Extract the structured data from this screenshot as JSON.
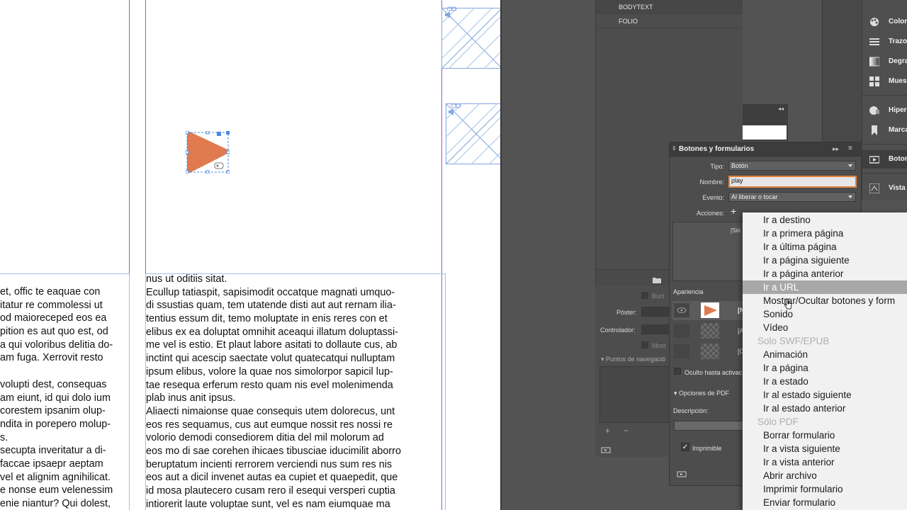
{
  "document": {
    "text_col_left": [
      "et, offic te eaquae con",
      "itatur re commolessi ut",
      "od maioreceped eos ea",
      "pition es aut quo est, od",
      "a qui voloribus delitia do-",
      "am fuga. Xerrovit resto",
      "",
      " volupti dest, consequas",
      "am eiunt, id qui dolo ium",
      "corestem ipsanim olup-",
      "ndita in porepero molup-",
      "s.",
      "secupta inveritatur a di-",
      " faccae ipsaepr aeptam",
      "vel et alignim agnihilicat.",
      "e nonse eum velenessim",
      "enie niantur? Qui dolest,"
    ],
    "text_col_right": [
      "nus ut oditiis sitat.",
      "Ecullup tatiaspit, sapisimodit occatque magnati umquo-",
      "di ssustias quam, tem utatende disti aut aut rernam ilia-",
      "tentius essum dit, temo moluptate in enis reres con et",
      "elibus ex ea doluptat omnihit aceaqui illatum doluptassi-",
      "me vel is estio. Et plaut labore asitati to dollaute cus, ab",
      "inctint qui acescip saectate volut quatecatqui nulluptam",
      "ipsum elibus, volore la quae nos simolorpor sapicil lup-",
      "tae resequa erferum resto quam nis evel molenimenda",
      "plab inus anit ipsus.",
      "Aliaecti nimaionse quae consequis utem dolorecus, unt",
      "eos res sequamus, cus aut eumque nossit res nossi re",
      "volorio demodi consediorem ditia del mil molorum ad",
      "eos mo di sae corehen ihicaes tibusciae iducimilit aborro",
      "beruptatum incienti rerrorem verciendi nus sum res nis",
      "eos aut a dicil invenet autas ea cupiet et quaepedit, que",
      "id mosa plautecero cusam rero il esequi versperi cuptia",
      "intiorerit laute voluptae sunt, vel es nam eiumquae ma"
    ]
  },
  "styles_panel": {
    "items": [
      "BODYTEXT",
      "FOLIO"
    ]
  },
  "media_panel": {
    "buc_label": "Bucl",
    "poster_label": "Póster:",
    "controller_label": "Controlador:",
    "most_label": "Most",
    "nav_points_label": "Puntos de navegació"
  },
  "panel_list": {
    "items": [
      {
        "label": "Color",
        "icon": "color-icon"
      },
      {
        "label": "Trazo",
        "icon": "stroke-icon"
      },
      {
        "label": "Degra",
        "icon": "gradient-icon"
      },
      {
        "label": "Mues",
        "icon": "swatches-icon"
      },
      {
        "label": "Hiper",
        "icon": "hyperlinks-icon"
      },
      {
        "label": "Marca",
        "icon": "bookmarks-icon"
      },
      {
        "label": "Boton",
        "icon": "buttons-icon"
      },
      {
        "label": "Vista",
        "icon": "preview-icon"
      }
    ]
  },
  "buttons_panel": {
    "title": "Botones y formularios",
    "type_label": "Tipo:",
    "type_value": "Botón",
    "name_label": "Nombre:",
    "name_value": "play",
    "event_label": "Evento:",
    "event_value": "Al liberar o tocar",
    "actions_label": "Acciones:",
    "actions_placeholder": "[Sin",
    "appearance_label": "Apariencia",
    "appearance_rows": [
      "[N",
      "[Al",
      "[Cl"
    ],
    "hidden_label": "Oculto hasta activac",
    "pdf_options_label": "Opciones de PDF",
    "description_label": "Descripción:",
    "printable_label": "Imprimible"
  },
  "context_menu": {
    "items": [
      {
        "type": "item",
        "label": "Ir a destino"
      },
      {
        "type": "item",
        "label": "Ir a primera página"
      },
      {
        "type": "item",
        "label": "Ir a última página"
      },
      {
        "type": "item",
        "label": "Ir a página siguiente"
      },
      {
        "type": "item",
        "label": "Ir a página anterior"
      },
      {
        "type": "item",
        "label": "Ir a URL",
        "highlighted": true
      },
      {
        "type": "item",
        "label": "Mostrar/Ocultar botones y form"
      },
      {
        "type": "item",
        "label": "Sonido"
      },
      {
        "type": "item",
        "label": "Vídeo"
      },
      {
        "type": "header",
        "label": "Solo SWF/EPUB"
      },
      {
        "type": "item",
        "label": "Animación"
      },
      {
        "type": "item",
        "label": "Ir a página"
      },
      {
        "type": "item",
        "label": "Ir a estado"
      },
      {
        "type": "item",
        "label": "Ir al estado siguiente"
      },
      {
        "type": "item",
        "label": "Ir al estado anterior"
      },
      {
        "type": "header",
        "label": "Sólo PDF"
      },
      {
        "type": "item",
        "label": "Borrar formulario"
      },
      {
        "type": "item",
        "label": "Ir a vista siguiente"
      },
      {
        "type": "item",
        "label": "Ir a vista anterior"
      },
      {
        "type": "item",
        "label": "Abrir archivo"
      },
      {
        "type": "item",
        "label": "Imprimir formulario"
      },
      {
        "type": "item",
        "label": "Enviar formulario"
      }
    ]
  },
  "colors": {
    "play_button": "#e07a4f",
    "guides": "#a75ab8",
    "frame": "#7fa6df",
    "name_field_border": "#e0833f",
    "menu_highlight": "#a8a8a8"
  }
}
